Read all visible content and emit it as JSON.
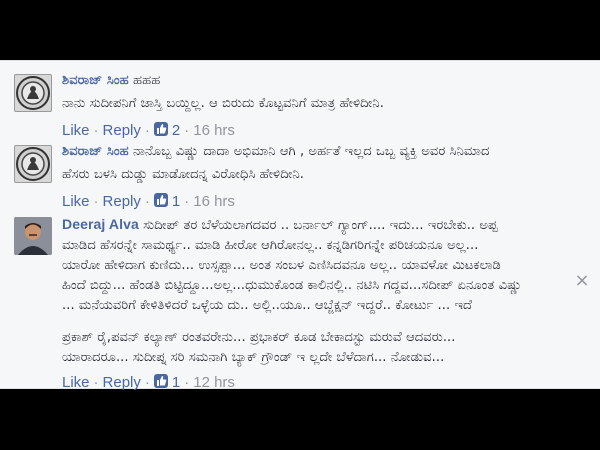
{
  "comments": [
    {
      "author": "ಶಿವರಾಜ್ ಸಿಂಹ",
      "lines": [
        "ಹಹಹ",
        "ನಾನು ಸುದೀಪನಿಗೆ ಜಾಸ್ತಿ ಬಯ್ದಿಲ್ಲ. ಆ ಬಿರುದು ಕೊಟ್ಟವನಿಗೆ ಮಾತ್ರ ಹೇಳಿದೀನಿ."
      ],
      "like_label": "Like",
      "reply_label": "Reply",
      "reactions": "2",
      "time": "16 hrs"
    },
    {
      "author": "ಶಿವರಾಜ್ ಸಿಂಹ",
      "lines": [
        "ನಾನೊಬ್ಬ ವಿಷ್ಣು ದಾದಾ ಅಭಿಮಾನಿ ಆಗಿ , ಅರ್ಹತೆ ಇಲ್ಲದ ಒಬ್ಬ ವ್ಯಕ್ತಿ ಅವರ ಸಿನಿಮಾದ",
        "ಹೆಸರು ಬಳಸಿ ದುಡ್ಡು ಮಾಡೋದನ್ನ ವಿರೋಧಿಸಿ ಹೇಳಿದೀನಿ."
      ],
      "like_label": "Like",
      "reply_label": "Reply",
      "reactions": "1",
      "time": "16 hrs"
    },
    {
      "author": "Deeraj Alva",
      "lines": [
        "ಸುದೀಪ್ ತರ ಬೆಳೆಯಲಾಗದವರ .. ಬರ್ನಾಲ್ ಗ್ಯಾಂಗ್.... ಇದು... ಇರಬೇಕು.. ಅಪ್ಪ",
        "ಮಾಡಿದ ಹೆಸರನ್ನೇ ಸಾಮರ್ಥ್ಯ.. ಮಾಡಿ ಹೀರೋ ಆಗಿರೋನಲ್ಲ.. ಕನ್ನಡಿಗರಿಗನ್ನೇ ಪರಿಚಯನೂ ಅಲ್ಲ...",
        "ಯಾರೋ ಹೇಳಿದಾಗ ಕುಣಿದು... ಉಸ್ಸಪ್ಪಾ... ಅಂತ ಸಂಬಳ ಎಣಿಸಿದವನೂ ಅಲ್ಲ.. ಯಾವಳೋ ಮಿಟಕಲಾಡಿ",
        "ಹಿಂದೆ ಬಿದ್ದು... ಹೆಂಡತಿ ಬಿಟ್ಟಿದ್ದೂ...ಅಲ್ಲ...ಧುಮುಕೊಂಡ ಕಾಲಿನಲ್ಲಿ.. ನಟಿಸಿ ಗದ್ದವ...ಸದೀಪ್ ಏನೂಂತ ವಿಷ್ಣು",
        "... ಮನೆಯವರಿಗೆ ಕೇಳಿತಿಳಿದರೆ ಒಳ್ಳೆಯ ದು.. ಅಲ್ಲಿ..ಯೂ.. ಆಬ್ಜೆಕ್ಷನ್ ಇದ್ದರೆ.. ಕೋರ್ಟು ... ಇದೆ",
        "",
        "ಪ್ರಕಾಶ್ ರೈ,ಪವನ್ ಕಲ್ಯಾಣ್ ರಂತವರೇನು... ಪ್ರಭಾಕರ್ ಕೂಡ ಬೇಕಾದಸ್ಟು ಮರುವೆ ಆದವರು...",
        "ಯಾರಾದರೂ... ಸುದೀಪ್ನ ಸರಿ ಸಮನಾಗಿ ಬ್ಯಾಕ್ ಗ್ರೌಂಡ್ ಇ ಲ್ಲದೇ ಬೆಳೆದಾಗ... ನೋಡುವ..."
      ],
      "like_label": "Like",
      "reply_label": "Reply",
      "reactions": "1",
      "time": "12 hrs"
    }
  ],
  "close_glyph": "×",
  "separator": "·",
  "colors": {
    "link": "#4b67a1",
    "meta": "#90949c",
    "text": "#1d2129",
    "panel": "#f6f7f9",
    "letterbox": "#000000"
  },
  "icons": [
    "seal-avatar-icon",
    "thumbs-up-icon",
    "close-icon"
  ]
}
